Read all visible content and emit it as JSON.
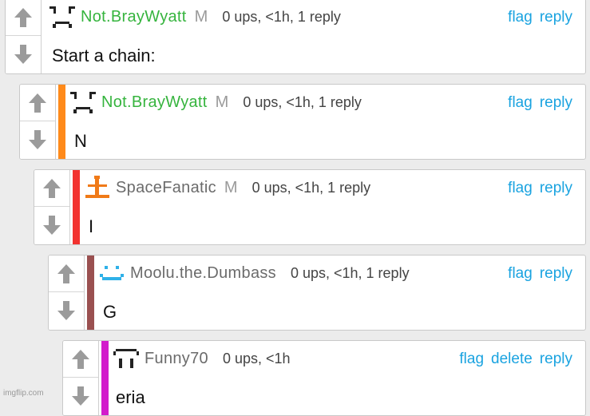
{
  "comments": [
    {
      "username": "Not.BrayWyatt",
      "mod": "M",
      "meta": "0 ups, <1h, 1 reply",
      "text": "Start a chain:",
      "flag": "flag",
      "reply": "reply",
      "name_color": "#36b43e",
      "stripe": null,
      "avatar": "frown-face-icon"
    },
    {
      "username": "Not.BrayWyatt",
      "mod": "M",
      "meta": "0 ups, <1h, 1 reply",
      "text": "N",
      "flag": "flag",
      "reply": "reply",
      "name_color": "#36b43e",
      "stripe": "#ff8a1a",
      "avatar": "frown-face-icon"
    },
    {
      "username": "SpaceFanatic",
      "mod": "M",
      "meta": "0 ups, <1h, 1 reply",
      "text": "I",
      "flag": "flag",
      "reply": "reply",
      "name_color": "#6b6b6b",
      "stripe": "#f2322f",
      "avatar": "rocket-icon"
    },
    {
      "username": "Moolu.the.Dumbass",
      "mod": "",
      "meta": "0 ups, <1h, 1 reply",
      "text": "G",
      "flag": "flag",
      "reply": "reply",
      "name_color": "#6b6b6b",
      "stripe": "#9a5050",
      "avatar": "smile-face-icon"
    },
    {
      "username": "Funny70",
      "mod": "",
      "meta": "0 ups, <1h",
      "text": "eria",
      "flag": "flag",
      "delete": "delete",
      "reply": "reply",
      "name_color": "#6b6b6b",
      "stripe": "#d21bcb",
      "avatar": "ghost-face-icon"
    }
  ],
  "watermark": "imgflip.com",
  "colors": {
    "link": "#1aa3e0",
    "arrow": "#9b9b9b",
    "background": "#ececec"
  }
}
